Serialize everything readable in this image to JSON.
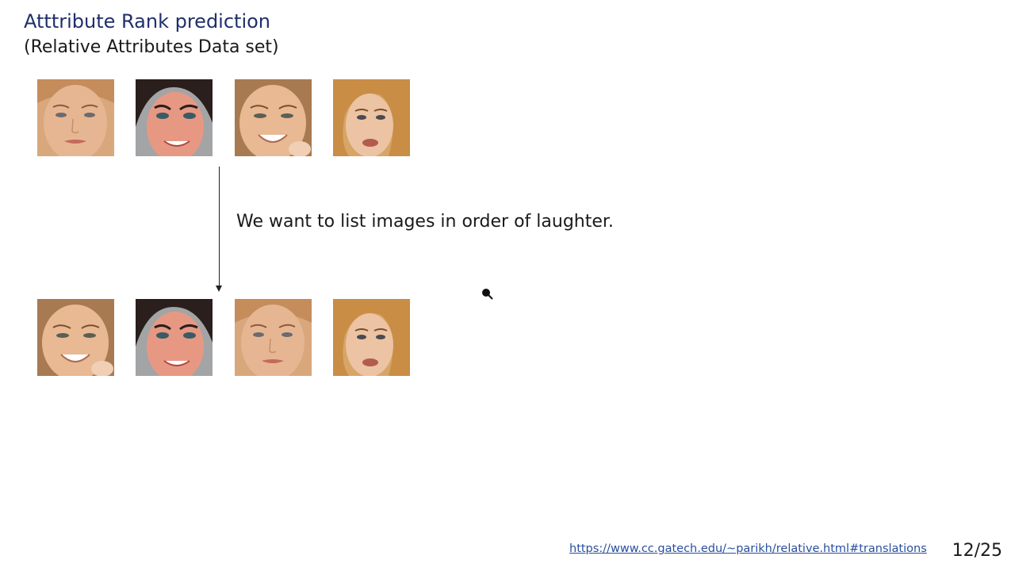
{
  "slide": {
    "title": "Atttribute Rank prediction",
    "subtitle": "(Relative Attributes Data set)",
    "caption": "We want to list images in order of laughter.",
    "link_text": "https://www.cc.gatech.edu/~parikh/relative.html#translations",
    "page_number": "12/25"
  },
  "images": {
    "top_row": [
      "face-a",
      "face-b",
      "face-c",
      "face-d"
    ],
    "bottom_row": [
      "face-c",
      "face-b",
      "face-a",
      "face-d"
    ]
  },
  "icons": {
    "arrow": "down-arrow-icon",
    "cursor": "pointer-cursor-icon"
  }
}
